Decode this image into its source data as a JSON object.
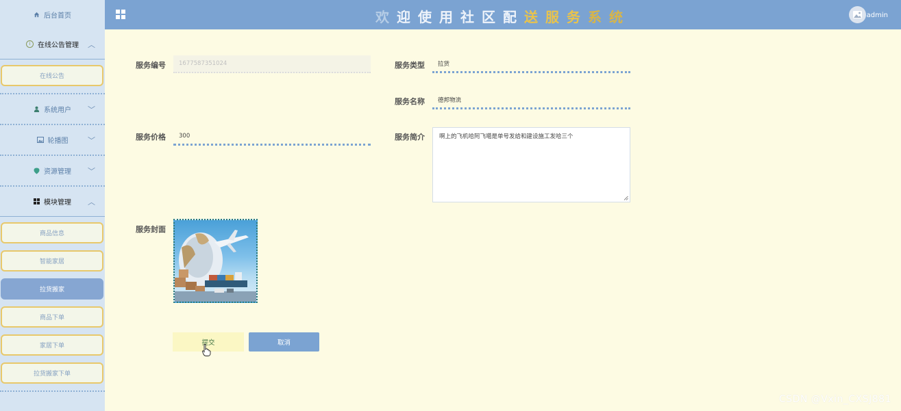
{
  "sidebar": {
    "home_label": "后台首页",
    "groups": [
      {
        "label": "在线公告管理",
        "icon": "info-icon",
        "expanded": true,
        "items": [
          "在线公告"
        ]
      },
      {
        "label": "系统用户",
        "icon": "user-icon",
        "expanded": false
      },
      {
        "label": "轮播图",
        "icon": "image-icon",
        "expanded": false
      },
      {
        "label": "资源管理",
        "icon": "pin-icon",
        "expanded": false
      },
      {
        "label": "模块管理",
        "icon": "grid-icon",
        "expanded": true,
        "items": [
          "商品信息",
          "智能家居",
          "拉货搬家",
          "商品下单",
          "家居下单",
          "拉货搬家下单"
        ],
        "selected": "拉货搬家"
      }
    ]
  },
  "header": {
    "title": "欢迎使用社区配送服务系统",
    "user_name": "admin",
    "colors": {
      "bar": "#7ba3d2",
      "accent_gold": "#e9c34c"
    }
  },
  "form": {
    "service_no": {
      "label": "服务编号",
      "value": "1677587351024"
    },
    "service_type": {
      "label": "服务类型",
      "value": "拉货"
    },
    "service_name": {
      "label": "服务名称",
      "value": "德邦物流"
    },
    "service_price": {
      "label": "服务价格",
      "value": "300"
    },
    "service_intro": {
      "label": "服务简介",
      "value": "啊上的飞机哈阿飞噶是单号发给和建设施工发哈三个"
    },
    "service_cover": {
      "label": "服务封面",
      "image": "logistics globe airplane ship boxes"
    },
    "submit_label": "提交",
    "cancel_label": "取消"
  },
  "watermark": "CSDN @Vxin_CXSJ881"
}
